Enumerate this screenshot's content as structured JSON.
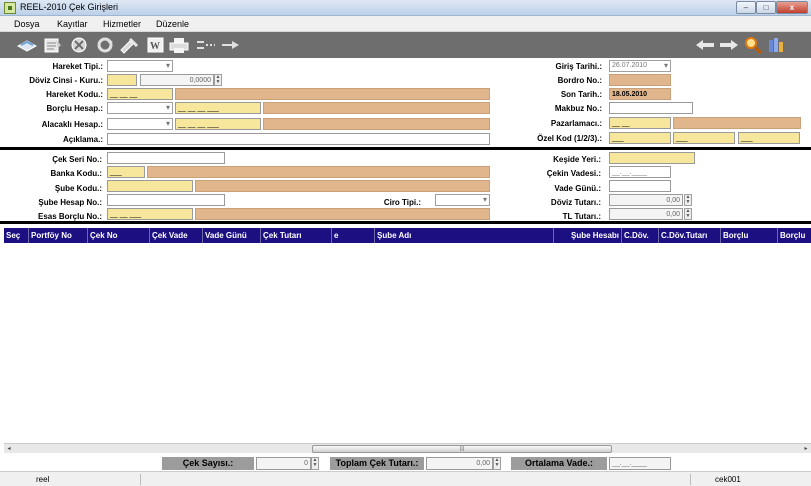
{
  "window": {
    "title": "REEL-2010 Çek Girişleri",
    "close_label": "x"
  },
  "menu": [
    "Dosya",
    "Kayıtlar",
    "Hizmetler",
    "Düzenle"
  ],
  "toolbar_icons": [
    "new-record-icon",
    "edit-record-icon",
    "delete-icon",
    "refresh-icon",
    "tools-icon",
    "word-icon",
    "print-icon",
    "collapse-icon",
    "expand-icon",
    "back-arrow-icon",
    "forward-arrow-icon",
    "search-icon",
    "report-icon"
  ],
  "form": {
    "hareket_tipi": "Hareket Tipi.:",
    "doviz_cinsi": "Döviz Cinsi - Kuru.:",
    "doviz_kuru": "0,0000",
    "hareket_kodu": "Hareket Kodu.:",
    "hareket_kodu_value": "__ __ __",
    "borclu_hesap": "Borçlu Hesap.:",
    "borclu_hesap_value": "__ __ __ ___",
    "alacakli_hesap": "Alacaklı Hesap.:",
    "alacakli_hesap_value": "__ __ __ ___",
    "aciklama": "Açıklama.:",
    "giris_tarihi": "Giriş Tarihi.:",
    "giris_tarihi_value": "26.07.2010",
    "bordro_no": "Bordro No.:",
    "son_tarih": "Son Tarih.:",
    "son_tarih_value": "18.05.2010",
    "makbuz_no": "Makbuz No.:",
    "pazarlamaci": "Pazarlamacı.:",
    "pazarlamaci_value": "__ __",
    "ozel_kod": "Özel Kod (1/2/3).:",
    "ozel_kod_1": "___",
    "ozel_kod_2": "___",
    "ozel_kod_3": "___",
    "cek_seri_no": "Çek Seri No.:",
    "banka_kodu": "Banka Kodu.:",
    "banka_kodu_value": "___",
    "sube_kodu": "Şube Kodu.:",
    "sube_hesap_no": "Şube Hesap No.:",
    "ciro_tipi": "Ciro Tipi.:",
    "esas_borclu_no": "Esas Borçlu No.:",
    "esas_borclu_value": "__ __ ___",
    "keside_yeri": "Keşide Yeri.:",
    "cekin_vadesi": "Çekin Vadesi.:",
    "cekin_vadesi_value": "__.__.____",
    "vade_gunu": "Vade Günü.:",
    "doviz_tutari": "Döviz Tutarı.:",
    "doviz_tutari_value": "0,00",
    "tl_tutari": "TL Tutarı.:",
    "tl_tutari_value": "0,00"
  },
  "grid": {
    "columns": [
      "Seç",
      "Portföy No",
      "Çek No",
      "Çek Vade",
      "Vade Günü",
      "Çek Tutarı",
      "e",
      "Şube Adı",
      "Şube Hesabı",
      "C.Döv.",
      "C.Döv.Tutarı",
      "Borçlu",
      "Borçlu"
    ]
  },
  "scroll_grip": "|||",
  "footer": {
    "cek_sayisi": "Çek Sayısı.:",
    "cek_sayisi_value": "0",
    "toplam_cek_tutari": "Toplam Çek Tutarı.:",
    "toplam_value": "0,00",
    "ortalama_vade": "Ortalama Vade.:",
    "ortalama_value": "__.__.____"
  },
  "status": {
    "left": "reel",
    "right": "cek001"
  }
}
